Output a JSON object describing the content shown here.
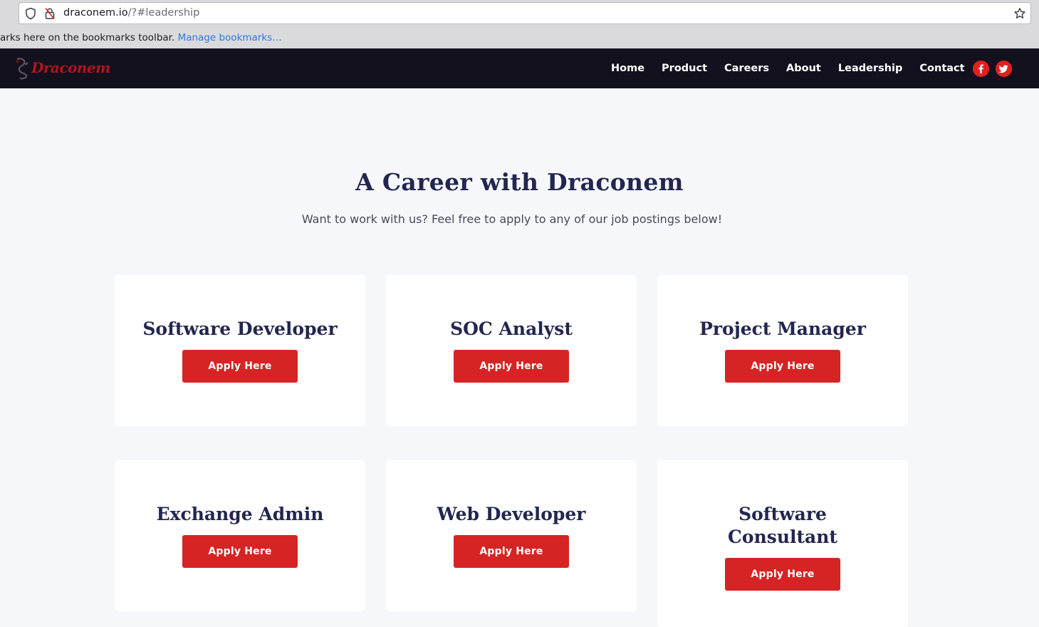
{
  "browser": {
    "url_host": "draconem.io",
    "url_path": "/?#leadership",
    "bookmarks_text": "arks here on the bookmarks toolbar.",
    "bookmarks_link": "Manage bookmarks…"
  },
  "nav": {
    "logo_text": "Draconem",
    "links": [
      "Home",
      "Product",
      "Careers",
      "About",
      "Leadership",
      "Contact"
    ],
    "social": [
      "facebook-icon",
      "twitter-icon"
    ]
  },
  "main": {
    "title": "A Career with Draconem",
    "subtitle": "Want to work with us? Feel free to apply to any of our job postings below!",
    "jobs": [
      {
        "title": "Software Developer",
        "button": "Apply Here"
      },
      {
        "title": "SOC Analyst",
        "button": "Apply Here"
      },
      {
        "title": "Project Manager",
        "button": "Apply Here"
      },
      {
        "title": "Exchange Admin",
        "button": "Apply Here"
      },
      {
        "title": "Web Developer",
        "button": "Apply Here"
      },
      {
        "title": "Software Consultant",
        "button": "Apply Here"
      }
    ]
  },
  "colors": {
    "nav_bg": "#14111f",
    "accent": "#d62424",
    "heading": "#23264f",
    "page_bg": "#f6f7fb"
  }
}
